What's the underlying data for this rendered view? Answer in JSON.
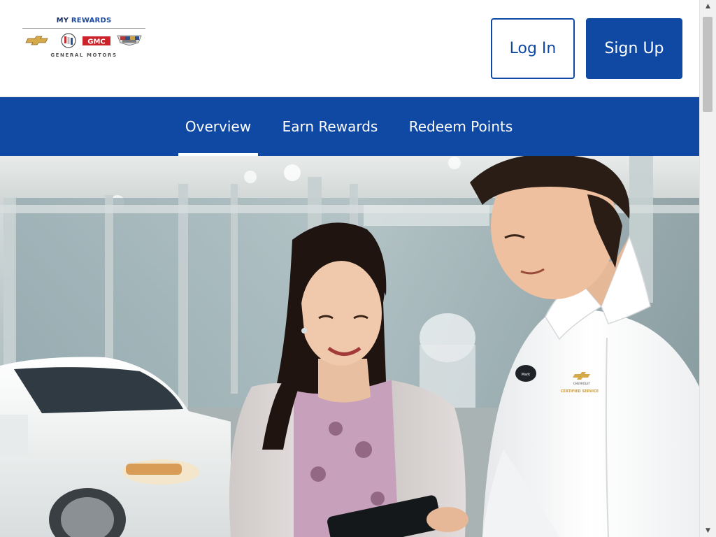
{
  "logo": {
    "title_my": "MY",
    "title_rewards": "REWARDS",
    "brands": [
      "Chevrolet",
      "Buick",
      "GMC",
      "Cadillac"
    ],
    "gmc_text": "GMC",
    "subtitle": "GENERAL MOTORS"
  },
  "header": {
    "login_label": "Log In",
    "signup_label": "Sign Up"
  },
  "nav": {
    "tabs": [
      {
        "label": "Overview",
        "active": true
      },
      {
        "label": "Earn Rewards",
        "active": false
      },
      {
        "label": "Redeem Points",
        "active": false
      }
    ]
  },
  "hero": {
    "scene": "dealership-showroom-photo",
    "badge_text": "Mark",
    "shirt_brand": "CHEVROLET",
    "shirt_text": "CERTIFIED SERVICE"
  },
  "colors": {
    "brand_blue": "#1049a3",
    "white": "#ffffff",
    "chevy_gold": "#d5a84a",
    "gmc_red": "#cc2229"
  }
}
